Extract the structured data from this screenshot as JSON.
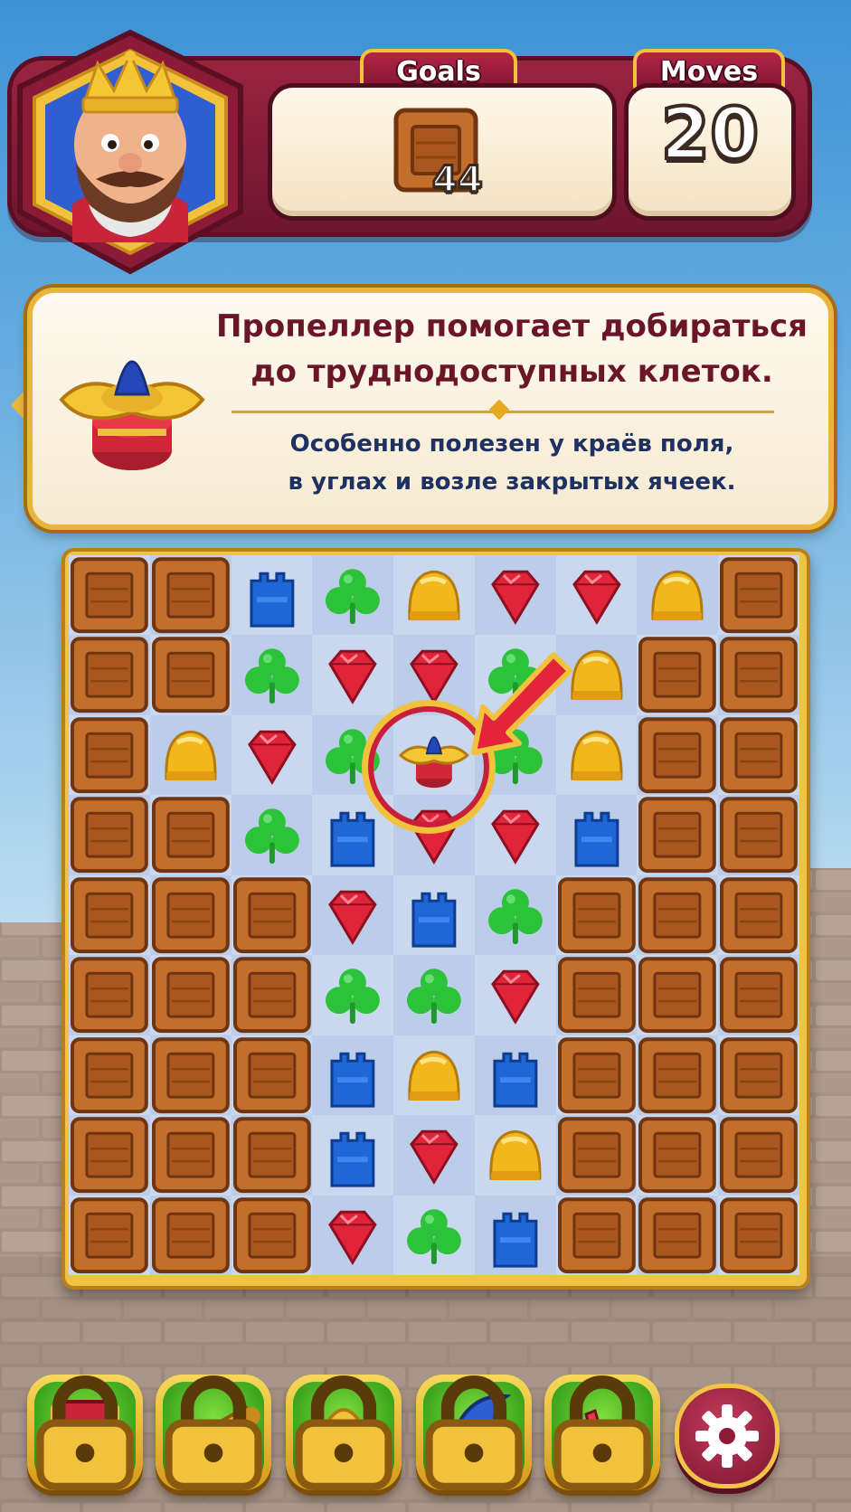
{
  "header": {
    "goals_label": "Goals",
    "moves_label": "Moves",
    "moves_remaining": "20",
    "goal_count": "44",
    "goal_item": "wooden-crate"
  },
  "tooltip": {
    "title_line1": "Пропеллер помогает добираться",
    "title_line2": "до труднодоступных клеток.",
    "body_line1": "Особенно полезен у краёв поля,",
    "body_line2": "в углах и возле закрытых ячеек.",
    "icon": "propeller-icon"
  },
  "board": {
    "columns": 9,
    "rows": 9,
    "legend": {
      "W": "crate",
      "B": "blue-tower",
      "G": "green-clover",
      "Y": "yellow-helmet",
      "R": "red-gem",
      "P": "propeller"
    },
    "cells": [
      [
        "W",
        "W",
        "B",
        "G",
        "Y",
        "R",
        "R",
        "Y",
        "W"
      ],
      [
        "W",
        "W",
        "G",
        "R",
        "R",
        "G",
        "Y",
        "W",
        "W"
      ],
      [
        "W",
        "Y",
        "R",
        "G",
        "P",
        "G",
        "Y",
        "W",
        "W"
      ],
      [
        "W",
        "W",
        "G",
        "B",
        "R",
        "R",
        "B",
        "W",
        "W"
      ],
      [
        "W",
        "W",
        "W",
        "R",
        "B",
        "G",
        "W",
        "W",
        "W"
      ],
      [
        "W",
        "W",
        "W",
        "G",
        "G",
        "R",
        "W",
        "W",
        "W"
      ],
      [
        "W",
        "W",
        "W",
        "B",
        "Y",
        "B",
        "W",
        "W",
        "W"
      ],
      [
        "W",
        "W",
        "W",
        "B",
        "R",
        "Y",
        "W",
        "W",
        "W"
      ],
      [
        "W",
        "W",
        "W",
        "R",
        "G",
        "B",
        "W",
        "W",
        "W"
      ]
    ],
    "highlight": {
      "row": 2,
      "col": 4,
      "pointer": "red-arrow"
    }
  },
  "boosters": [
    {
      "name": "hammer",
      "locked": true
    },
    {
      "name": "cannon",
      "locked": true
    },
    {
      "name": "arrow-tower",
      "locked": true
    },
    {
      "name": "wizard-hat",
      "locked": true
    },
    {
      "name": "plane",
      "locked": true
    }
  ],
  "colors": {
    "accent": "#7a1430",
    "gold": "#f1c445",
    "crate": "#c46e2c",
    "red": "#e0243a",
    "blue": "#1f66d6",
    "green": "#2cc23a",
    "yellow": "#f2b81b"
  }
}
